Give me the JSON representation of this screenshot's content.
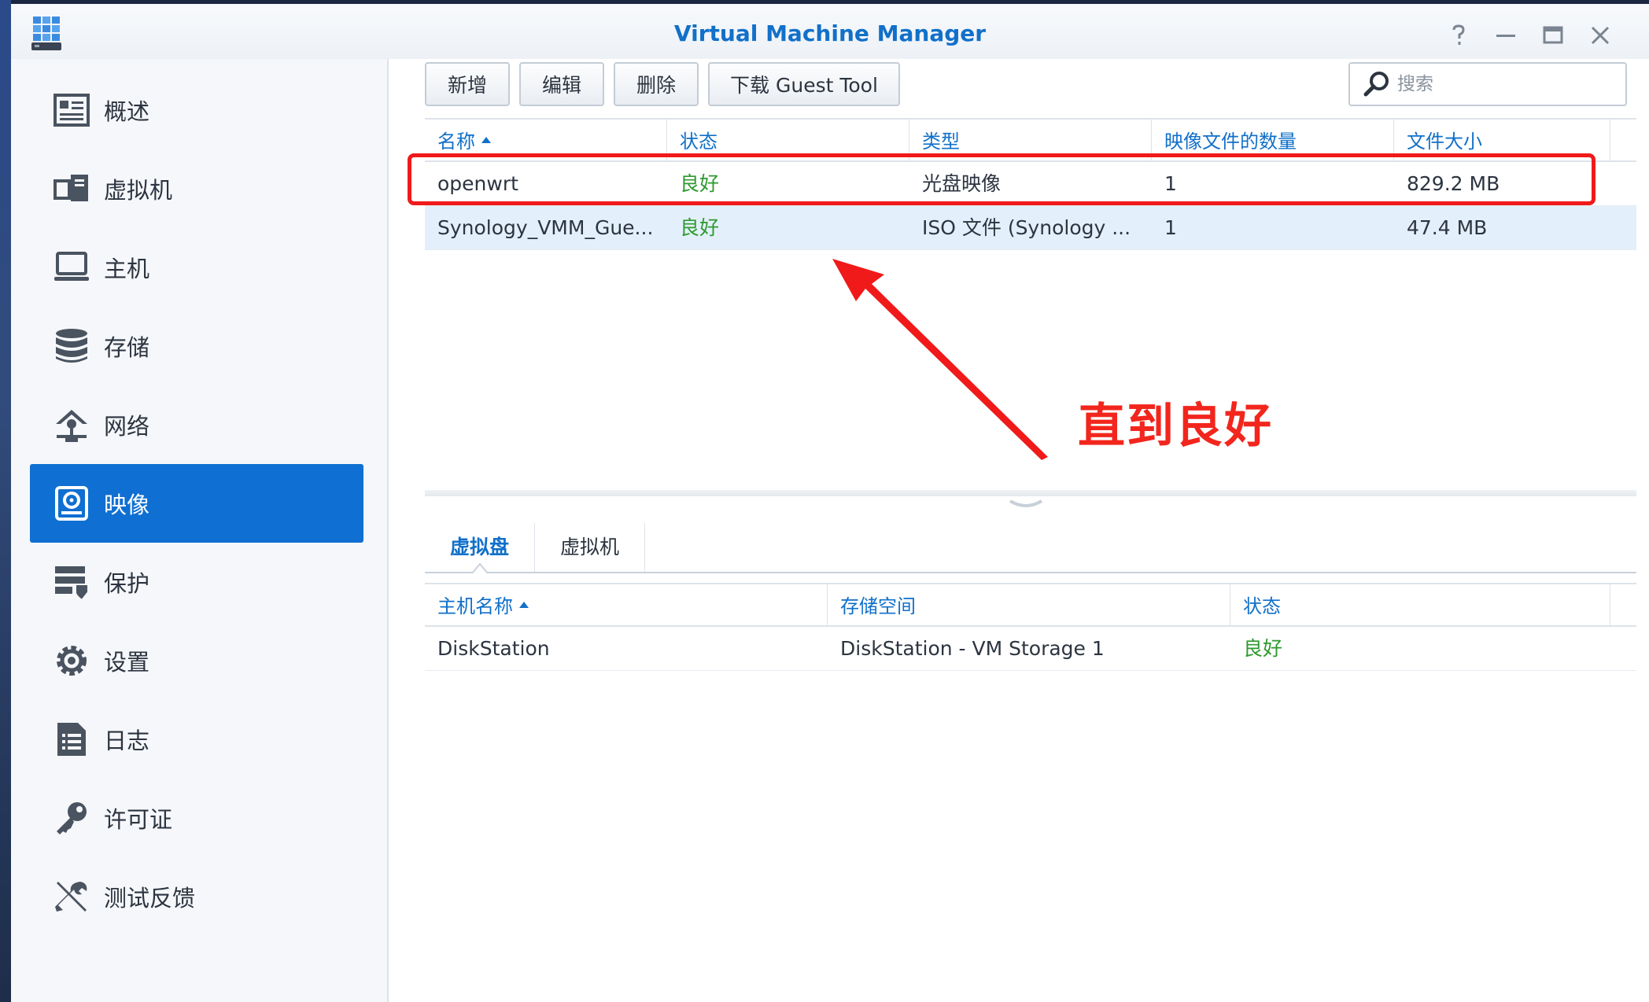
{
  "window": {
    "title": "Virtual Machine Manager",
    "controls": [
      "help-icon",
      "minimize-icon",
      "maximize-icon",
      "close-icon"
    ]
  },
  "sidebar": {
    "items": [
      {
        "label": "概述",
        "icon": "overview-icon"
      },
      {
        "label": "虚拟机",
        "icon": "virtual-machine-icon"
      },
      {
        "label": "主机",
        "icon": "host-icon"
      },
      {
        "label": "存储",
        "icon": "storage-icon"
      },
      {
        "label": "网络",
        "icon": "network-icon"
      },
      {
        "label": "映像",
        "icon": "image-icon",
        "active": true
      },
      {
        "label": "保护",
        "icon": "protection-icon"
      },
      {
        "label": "设置",
        "icon": "gear-icon"
      },
      {
        "label": "日志",
        "icon": "log-icon"
      },
      {
        "label": "许可证",
        "icon": "key-icon"
      },
      {
        "label": "测试反馈",
        "icon": "tools-icon"
      }
    ]
  },
  "toolbar": {
    "add_label": "新增",
    "edit_label": "编辑",
    "delete_label": "删除",
    "download_label": "下载 Guest Tool"
  },
  "search": {
    "placeholder": "搜索"
  },
  "images_table": {
    "columns": [
      "名称",
      "状态",
      "类型",
      "映像文件的数量",
      "文件大小"
    ],
    "sort_column": "名称",
    "rows": [
      [
        "openwrt",
        "良好",
        "光盘映像",
        "1",
        "829.2 MB"
      ],
      [
        "Synology_VMM_Gue...",
        "良好",
        "ISO 文件 (Synology ...",
        "1",
        "47.4 MB"
      ]
    ],
    "selected_row": 1
  },
  "annotation": {
    "text": "直到良好",
    "color": "#f2261d"
  },
  "detail_tabs": {
    "tabs": [
      "虚拟盘",
      "虚拟机"
    ],
    "active": 0
  },
  "detail_table": {
    "columns": [
      "主机名称",
      "存储空间",
      "状态"
    ],
    "sort_column": "主机名称",
    "rows": [
      [
        "DiskStation",
        "DiskStation - VM Storage 1",
        "良好"
      ]
    ]
  },
  "colors": {
    "accent": "#1170c9",
    "active_nav": "#0f6fd2",
    "status_good": "#2f9a2f",
    "highlight": "#f01a1a"
  }
}
